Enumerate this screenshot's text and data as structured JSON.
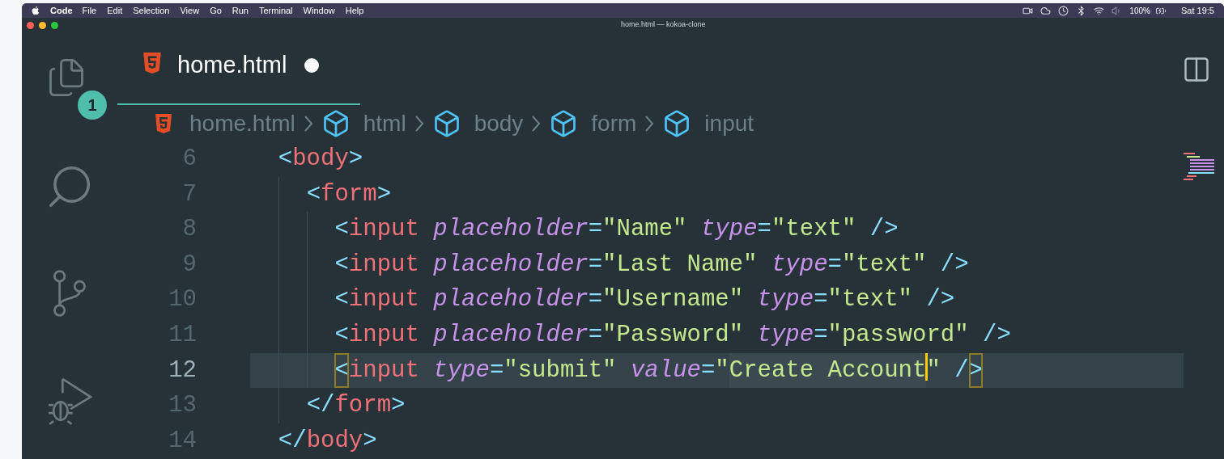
{
  "menu_bar": {
    "app": "Code",
    "items": [
      "File",
      "Edit",
      "Selection",
      "View",
      "Go",
      "Run",
      "Terminal",
      "Window",
      "Help"
    ],
    "battery": "100%",
    "clock": "Sat 19:5"
  },
  "window": {
    "title": "home.html — kokoa-clone"
  },
  "activity_bar": {
    "badge": "1"
  },
  "tabs": [
    {
      "label": "home.html",
      "selected": true,
      "modified": true
    }
  ],
  "breadcrumb": [
    {
      "kind": "file",
      "label": "home.html"
    },
    {
      "kind": "element",
      "label": "html"
    },
    {
      "kind": "element",
      "label": "body"
    },
    {
      "kind": "element",
      "label": "form"
    },
    {
      "kind": "element",
      "label": "input"
    }
  ],
  "lines": [
    {
      "number": "6",
      "current": false,
      "tokens": [
        {
          "kind": "punct",
          "text": "  <"
        },
        {
          "kind": "tag",
          "text": "body"
        },
        {
          "kind": "punct",
          "text": ">"
        }
      ]
    },
    {
      "number": "7",
      "current": false,
      "tokens": [
        {
          "kind": "punct",
          "text": "    <"
        },
        {
          "kind": "tag",
          "text": "form"
        },
        {
          "kind": "punct",
          "text": ">"
        }
      ]
    },
    {
      "number": "8",
      "current": false,
      "tokens": [
        {
          "kind": "punct",
          "text": "      <"
        },
        {
          "kind": "tag",
          "text": "input"
        },
        {
          "kind": "attr",
          "text": " placeholder"
        },
        {
          "kind": "punct",
          "text": "="
        },
        {
          "kind": "string",
          "text": "\"Name\""
        },
        {
          "kind": "attr",
          "text": " type"
        },
        {
          "kind": "punct",
          "text": "="
        },
        {
          "kind": "string",
          "text": "\"text\""
        },
        {
          "kind": "punct",
          "text": " />"
        }
      ]
    },
    {
      "number": "9",
      "current": false,
      "tokens": [
        {
          "kind": "punct",
          "text": "      <"
        },
        {
          "kind": "tag",
          "text": "input"
        },
        {
          "kind": "attr",
          "text": " placeholder"
        },
        {
          "kind": "punct",
          "text": "="
        },
        {
          "kind": "string",
          "text": "\"Last Name\""
        },
        {
          "kind": "attr",
          "text": " type"
        },
        {
          "kind": "punct",
          "text": "="
        },
        {
          "kind": "string",
          "text": "\"text\""
        },
        {
          "kind": "punct",
          "text": " />"
        }
      ]
    },
    {
      "number": "10",
      "current": false,
      "tokens": [
        {
          "kind": "punct",
          "text": "      <"
        },
        {
          "kind": "tag",
          "text": "input"
        },
        {
          "kind": "attr",
          "text": " placeholder"
        },
        {
          "kind": "punct",
          "text": "="
        },
        {
          "kind": "string",
          "text": "\"Username\""
        },
        {
          "kind": "attr",
          "text": " type"
        },
        {
          "kind": "punct",
          "text": "="
        },
        {
          "kind": "string",
          "text": "\"text\""
        },
        {
          "kind": "punct",
          "text": " />"
        }
      ]
    },
    {
      "number": "11",
      "current": false,
      "tokens": [
        {
          "kind": "punct",
          "text": "      <"
        },
        {
          "kind": "tag",
          "text": "input"
        },
        {
          "kind": "attr",
          "text": " placeholder"
        },
        {
          "kind": "punct",
          "text": "="
        },
        {
          "kind": "string",
          "text": "\"Password\""
        },
        {
          "kind": "attr",
          "text": " type"
        },
        {
          "kind": "punct",
          "text": "="
        },
        {
          "kind": "string",
          "text": "\"password\""
        },
        {
          "kind": "punct",
          "text": " />"
        }
      ]
    },
    {
      "number": "12",
      "current": true,
      "tokens": [
        {
          "kind": "bracket_match",
          "text": "      <"
        },
        {
          "kind": "tag",
          "text": "input"
        },
        {
          "kind": "attr",
          "text": " type"
        },
        {
          "kind": "punct",
          "text": "="
        },
        {
          "kind": "string",
          "text": "\"submit\""
        },
        {
          "kind": "attr",
          "text": " value"
        },
        {
          "kind": "punct",
          "text": "="
        },
        {
          "kind": "string",
          "text": "\""
        },
        {
          "kind": "highlight",
          "text": "Create Account"
        },
        {
          "kind": "cursor"
        },
        {
          "kind": "string",
          "text": "\""
        },
        {
          "kind": "punct",
          "text": " /"
        },
        {
          "kind": "bracket_match",
          "text": ">"
        }
      ]
    },
    {
      "number": "13",
      "current": false,
      "tokens": [
        {
          "kind": "punct",
          "text": "    </"
        },
        {
          "kind": "tag",
          "text": "form"
        },
        {
          "kind": "punct",
          "text": ">"
        }
      ]
    },
    {
      "number": "14",
      "current": false,
      "tokens": [
        {
          "kind": "punct",
          "text": "  </"
        },
        {
          "kind": "tag",
          "text": "body"
        },
        {
          "kind": "punct",
          "text": ">"
        }
      ]
    }
  ]
}
